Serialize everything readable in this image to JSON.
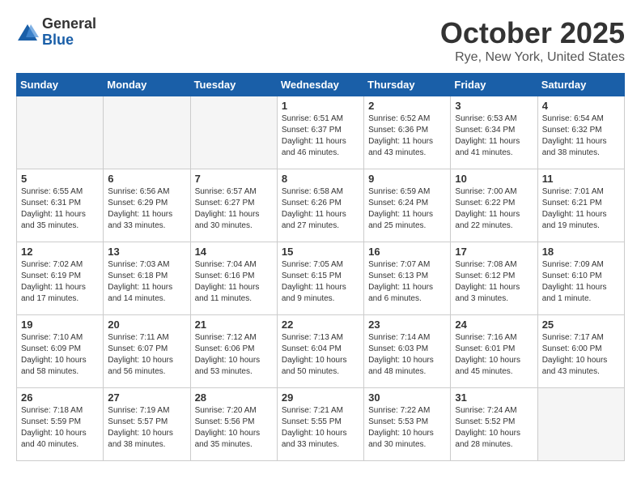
{
  "logo": {
    "general": "General",
    "blue": "Blue"
  },
  "header": {
    "month": "October 2025",
    "location": "Rye, New York, United States"
  },
  "weekdays": [
    "Sunday",
    "Monday",
    "Tuesday",
    "Wednesday",
    "Thursday",
    "Friday",
    "Saturday"
  ],
  "weeks": [
    [
      {
        "day": "",
        "info": ""
      },
      {
        "day": "",
        "info": ""
      },
      {
        "day": "",
        "info": ""
      },
      {
        "day": "1",
        "info": "Sunrise: 6:51 AM\nSunset: 6:37 PM\nDaylight: 11 hours\nand 46 minutes."
      },
      {
        "day": "2",
        "info": "Sunrise: 6:52 AM\nSunset: 6:36 PM\nDaylight: 11 hours\nand 43 minutes."
      },
      {
        "day": "3",
        "info": "Sunrise: 6:53 AM\nSunset: 6:34 PM\nDaylight: 11 hours\nand 41 minutes."
      },
      {
        "day": "4",
        "info": "Sunrise: 6:54 AM\nSunset: 6:32 PM\nDaylight: 11 hours\nand 38 minutes."
      }
    ],
    [
      {
        "day": "5",
        "info": "Sunrise: 6:55 AM\nSunset: 6:31 PM\nDaylight: 11 hours\nand 35 minutes."
      },
      {
        "day": "6",
        "info": "Sunrise: 6:56 AM\nSunset: 6:29 PM\nDaylight: 11 hours\nand 33 minutes."
      },
      {
        "day": "7",
        "info": "Sunrise: 6:57 AM\nSunset: 6:27 PM\nDaylight: 11 hours\nand 30 minutes."
      },
      {
        "day": "8",
        "info": "Sunrise: 6:58 AM\nSunset: 6:26 PM\nDaylight: 11 hours\nand 27 minutes."
      },
      {
        "day": "9",
        "info": "Sunrise: 6:59 AM\nSunset: 6:24 PM\nDaylight: 11 hours\nand 25 minutes."
      },
      {
        "day": "10",
        "info": "Sunrise: 7:00 AM\nSunset: 6:22 PM\nDaylight: 11 hours\nand 22 minutes."
      },
      {
        "day": "11",
        "info": "Sunrise: 7:01 AM\nSunset: 6:21 PM\nDaylight: 11 hours\nand 19 minutes."
      }
    ],
    [
      {
        "day": "12",
        "info": "Sunrise: 7:02 AM\nSunset: 6:19 PM\nDaylight: 11 hours\nand 17 minutes."
      },
      {
        "day": "13",
        "info": "Sunrise: 7:03 AM\nSunset: 6:18 PM\nDaylight: 11 hours\nand 14 minutes."
      },
      {
        "day": "14",
        "info": "Sunrise: 7:04 AM\nSunset: 6:16 PM\nDaylight: 11 hours\nand 11 minutes."
      },
      {
        "day": "15",
        "info": "Sunrise: 7:05 AM\nSunset: 6:15 PM\nDaylight: 11 hours\nand 9 minutes."
      },
      {
        "day": "16",
        "info": "Sunrise: 7:07 AM\nSunset: 6:13 PM\nDaylight: 11 hours\nand 6 minutes."
      },
      {
        "day": "17",
        "info": "Sunrise: 7:08 AM\nSunset: 6:12 PM\nDaylight: 11 hours\nand 3 minutes."
      },
      {
        "day": "18",
        "info": "Sunrise: 7:09 AM\nSunset: 6:10 PM\nDaylight: 11 hours\nand 1 minute."
      }
    ],
    [
      {
        "day": "19",
        "info": "Sunrise: 7:10 AM\nSunset: 6:09 PM\nDaylight: 10 hours\nand 58 minutes."
      },
      {
        "day": "20",
        "info": "Sunrise: 7:11 AM\nSunset: 6:07 PM\nDaylight: 10 hours\nand 56 minutes."
      },
      {
        "day": "21",
        "info": "Sunrise: 7:12 AM\nSunset: 6:06 PM\nDaylight: 10 hours\nand 53 minutes."
      },
      {
        "day": "22",
        "info": "Sunrise: 7:13 AM\nSunset: 6:04 PM\nDaylight: 10 hours\nand 50 minutes."
      },
      {
        "day": "23",
        "info": "Sunrise: 7:14 AM\nSunset: 6:03 PM\nDaylight: 10 hours\nand 48 minutes."
      },
      {
        "day": "24",
        "info": "Sunrise: 7:16 AM\nSunset: 6:01 PM\nDaylight: 10 hours\nand 45 minutes."
      },
      {
        "day": "25",
        "info": "Sunrise: 7:17 AM\nSunset: 6:00 PM\nDaylight: 10 hours\nand 43 minutes."
      }
    ],
    [
      {
        "day": "26",
        "info": "Sunrise: 7:18 AM\nSunset: 5:59 PM\nDaylight: 10 hours\nand 40 minutes."
      },
      {
        "day": "27",
        "info": "Sunrise: 7:19 AM\nSunset: 5:57 PM\nDaylight: 10 hours\nand 38 minutes."
      },
      {
        "day": "28",
        "info": "Sunrise: 7:20 AM\nSunset: 5:56 PM\nDaylight: 10 hours\nand 35 minutes."
      },
      {
        "day": "29",
        "info": "Sunrise: 7:21 AM\nSunset: 5:55 PM\nDaylight: 10 hours\nand 33 minutes."
      },
      {
        "day": "30",
        "info": "Sunrise: 7:22 AM\nSunset: 5:53 PM\nDaylight: 10 hours\nand 30 minutes."
      },
      {
        "day": "31",
        "info": "Sunrise: 7:24 AM\nSunset: 5:52 PM\nDaylight: 10 hours\nand 28 minutes."
      },
      {
        "day": "",
        "info": ""
      }
    ]
  ]
}
